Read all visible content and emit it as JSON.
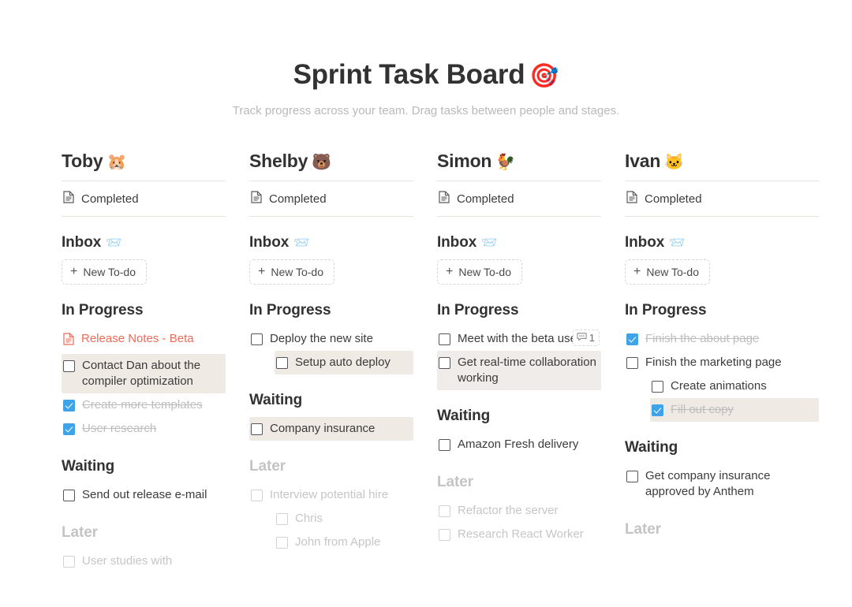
{
  "header": {
    "title": "Sprint Task Board",
    "title_emoji": "🎯",
    "subtitle": "Track progress across your team.  Drag tasks between people and stages."
  },
  "labels": {
    "completed": "Completed",
    "new_todo": "New To-do",
    "plus": "+",
    "inbox": "Inbox",
    "in_progress": "In Progress",
    "waiting": "Waiting",
    "later": "Later",
    "inbox_emoji": "📨"
  },
  "colors": {
    "accent_blue": "#3fa3e8",
    "doc_red": "#ee6a58",
    "highlight": "#f0eae5",
    "muted_text": "#c4c4c4",
    "title_text": "#323232"
  },
  "columns": [
    {
      "name": "Toby",
      "emoji": "🐹",
      "in_progress": [
        {
          "text": "Release Notes - Beta",
          "type": "doc",
          "checked": false,
          "indent": 0,
          "highlight": false,
          "dim": false
        },
        {
          "text": "Contact Dan about the compiler optimization",
          "type": "task",
          "checked": false,
          "indent": 0,
          "highlight": true,
          "dim": false
        },
        {
          "text": "Create more templates",
          "type": "task",
          "checked": true,
          "indent": 0,
          "highlight": false,
          "dim": false
        },
        {
          "text": "User research",
          "type": "task",
          "checked": true,
          "indent": 0,
          "highlight": false,
          "dim": false
        }
      ],
      "waiting": [
        {
          "text": "Send out release e-mail",
          "type": "task",
          "checked": false,
          "indent": 0,
          "highlight": false,
          "dim": false
        }
      ],
      "later": [
        {
          "text": "User studies with",
          "type": "task",
          "checked": false,
          "indent": 0,
          "highlight": false,
          "dim": true
        }
      ]
    },
    {
      "name": "Shelby",
      "emoji": "🐻",
      "in_progress": [
        {
          "text": "Deploy the new site",
          "type": "task",
          "checked": false,
          "indent": 0,
          "highlight": false,
          "dim": false
        },
        {
          "text": "Setup auto deploy",
          "type": "task",
          "checked": false,
          "indent": 1,
          "highlight": true,
          "dim": false
        }
      ],
      "waiting": [
        {
          "text": "Company insurance",
          "type": "task",
          "checked": false,
          "indent": 0,
          "highlight": true,
          "dim": false
        }
      ],
      "later": [
        {
          "text": "Interview potential hire",
          "type": "task",
          "checked": false,
          "indent": 0,
          "highlight": false,
          "dim": true
        },
        {
          "text": "Chris",
          "type": "task",
          "checked": false,
          "indent": 1,
          "highlight": false,
          "dim": true
        },
        {
          "text": "John from Apple",
          "type": "task",
          "checked": false,
          "indent": 1,
          "highlight": false,
          "dim": true
        }
      ]
    },
    {
      "name": "Simon",
      "emoji": "🐓",
      "in_progress": [
        {
          "text": "Meet with the beta users",
          "type": "task",
          "checked": false,
          "indent": 0,
          "highlight": false,
          "dim": false,
          "comments": "1"
        },
        {
          "text": "Get real-time collaboration working",
          "type": "task",
          "checked": false,
          "indent": 0,
          "highlight": true,
          "dim": false
        }
      ],
      "waiting": [
        {
          "text": "Amazon Fresh delivery",
          "type": "task",
          "checked": false,
          "indent": 0,
          "highlight": false,
          "dim": false
        }
      ],
      "later": [
        {
          "text": "Refactor the server",
          "type": "task",
          "checked": false,
          "indent": 0,
          "highlight": false,
          "dim": true
        },
        {
          "text": "Research React Worker",
          "type": "task",
          "checked": false,
          "indent": 0,
          "highlight": false,
          "dim": true
        }
      ]
    },
    {
      "name": "Ivan",
      "emoji": "🐱",
      "in_progress": [
        {
          "text": "Finish the about page",
          "type": "task",
          "checked": true,
          "indent": 0,
          "highlight": false,
          "dim": false
        },
        {
          "text": "Finish the marketing page",
          "type": "task",
          "checked": false,
          "indent": 0,
          "highlight": false,
          "dim": false
        },
        {
          "text": "Create animations",
          "type": "task",
          "checked": false,
          "indent": 1,
          "highlight": false,
          "dim": false
        },
        {
          "text": "Fill out copy",
          "type": "task",
          "checked": true,
          "indent": 1,
          "highlight": true,
          "dim": false
        }
      ],
      "waiting": [
        {
          "text": "Get company insurance approved by Anthem",
          "type": "task",
          "checked": false,
          "indent": 0,
          "highlight": false,
          "dim": false
        }
      ],
      "later": []
    }
  ]
}
